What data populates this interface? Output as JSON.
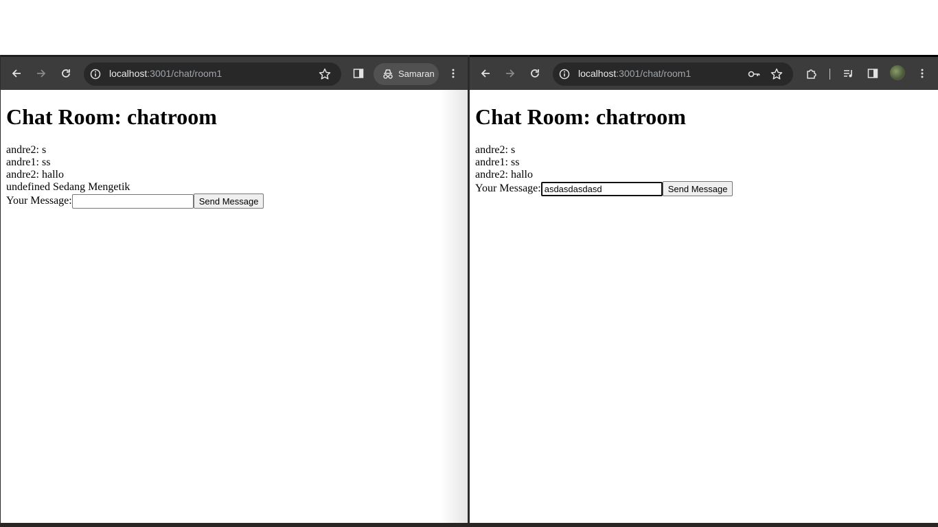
{
  "left_window": {
    "url_host": "localhost",
    "url_path": ":3001/chat/room1",
    "profile_label": "Samaran",
    "page": {
      "title": "Chat Room: chatroom",
      "messages": [
        "andre2: s",
        "andre1: ss",
        "andre2: hallo"
      ],
      "typing_status": "undefined Sedang Mengetik",
      "form_label": "Your Message:",
      "input_value": "",
      "send_label": "Send Message"
    }
  },
  "right_window": {
    "url_host": "localhost",
    "url_path": ":3001/chat/room1",
    "page": {
      "title": "Chat Room: chatroom",
      "messages": [
        "andre2: s",
        "andre1: ss",
        "andre2: hallo"
      ],
      "form_label": "Your Message:",
      "input_value": "asdasdasdasd",
      "send_label": "Send Message"
    }
  },
  "colors": {
    "toolbar_bg": "#3c3c3c",
    "omnibox_bg": "#282828",
    "page_bg": "#ffffff"
  },
  "icons": [
    "back-arrow-icon",
    "forward-arrow-icon",
    "reload-icon",
    "site-info-icon",
    "star-icon",
    "side-panel-icon",
    "incognito-icon",
    "menu-dots-icon",
    "password-key-icon",
    "extensions-icon",
    "media-queue-icon"
  ]
}
